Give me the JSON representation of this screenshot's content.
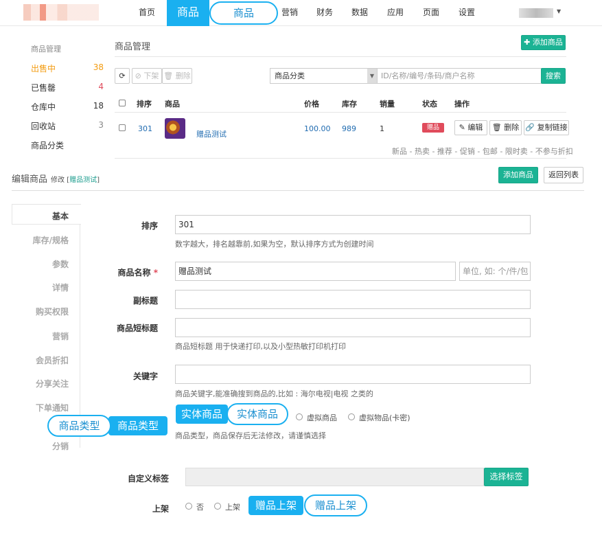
{
  "nav": {
    "items": [
      "首页",
      "商品",
      "营销",
      "财务",
      "数据",
      "应用",
      "页面",
      "设置"
    ],
    "active_callout": "商品"
  },
  "sidebar": {
    "heading": "商品管理",
    "items": [
      {
        "label": "出售中",
        "count": "38"
      },
      {
        "label": "已售罄",
        "count": "4"
      },
      {
        "label": "仓库中",
        "count": "18"
      },
      {
        "label": "回收站",
        "count": "3"
      },
      {
        "label": "商品分类",
        "count": ""
      }
    ]
  },
  "product_panel": {
    "title": "商品管理",
    "add_button": "✚ 添加商品",
    "refresh_icon": "⟳",
    "offshelf_button": "⊘ 下架",
    "delete_button": "🗑 删除",
    "category_select": "商品分类",
    "search_placeholder": "ID/名称/编号/条码/商户名称",
    "search_button": "搜索",
    "columns": [
      "排序",
      "商品",
      "价格",
      "库存",
      "销量",
      "状态",
      "操作"
    ],
    "row": {
      "sort": "301",
      "name": "赠品测试",
      "price": "100.00",
      "stock": "989",
      "sales": "1",
      "status": "赠品",
      "edit": "✎ 编辑",
      "remove": "🗑 删除",
      "copy": "🔗 复制链接"
    },
    "tags": "新品 - 热卖 - 推荐 - 促销 - 包邮 - 限时卖 - 不参与折扣"
  },
  "edit": {
    "title": "编辑商品",
    "subtitle_prefix": "修改 [",
    "subtitle_link": "赠品测试",
    "subtitle_suffix": "]",
    "add_button": "添加商品",
    "back_button": "返回列表",
    "tabs": [
      "基本",
      "库存/规格",
      "参数",
      "详情",
      "购买权限",
      "营销",
      "会员折扣",
      "分享关注",
      "下单通知",
      "分销"
    ],
    "fields": {
      "sort_label": "排序",
      "sort_value": "301",
      "sort_help": "数字越大，排名越靠前,如果为空，默认排序方式为创建时间",
      "name_label": "商品名称",
      "name_required": "*",
      "name_value": "赠品测试",
      "unit_placeholder": "单位, 如: 个/件/包",
      "subtitle_label": "副标题",
      "short_label": "商品短标题",
      "short_help": "商品短标题 用于快递打印,以及小型热敏打印机打印",
      "keyword_label": "关键字",
      "keyword_help": "商品关键字,能准确搜到商品的,比如 : 海尔电视|电视 之类的",
      "type_help": "商品类型，商品保存后无法修改，请谨慎选择",
      "type_options": [
        "虚拟商品",
        "虚拟物品(卡密)"
      ],
      "custom_tag_label": "自定义标签",
      "select_tag_button": "选择标签",
      "shelf_label": "上架",
      "shelf_options": [
        "否",
        "上架"
      ]
    }
  },
  "callouts": {
    "goods_type": "商品类型",
    "physical": "实体商品",
    "gift_shelf": "赠品上架"
  },
  "colors": {
    "accent": "#1ab0f0",
    "green": "#1bb394",
    "red": "#e04b5b",
    "orange": "#f39c12"
  }
}
